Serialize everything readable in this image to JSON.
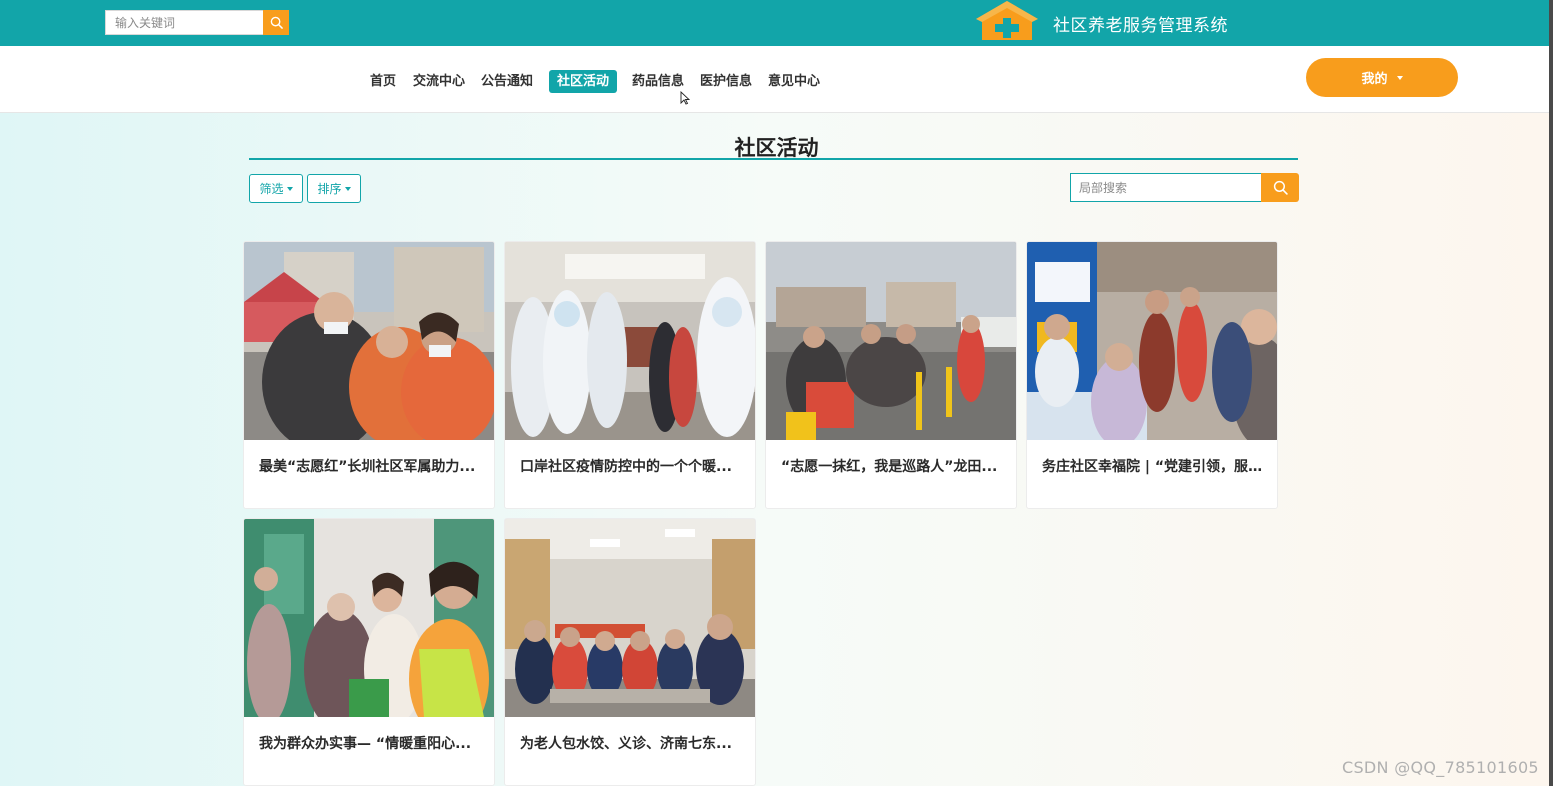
{
  "topbar": {
    "search_placeholder": "输入关键词",
    "search_icon": "search-icon",
    "brand_title": "社区养老服务管理系统",
    "brand_icon": "house-plus-icon",
    "bg_color": "#12a5a9"
  },
  "nav": {
    "items": [
      {
        "label": "首页"
      },
      {
        "label": "交流中心"
      },
      {
        "label": "公告通知"
      },
      {
        "label": "社区活动",
        "active": true
      },
      {
        "label": "药品信息"
      },
      {
        "label": "医护信息"
      },
      {
        "label": "意见中心"
      }
    ],
    "user_menu": "我的"
  },
  "page": {
    "title": "社区活动",
    "filter_label": "筛选",
    "sort_label": "排序",
    "local_search_placeholder": "局部搜索"
  },
  "cards": [
    {
      "title": "最美“志愿红”长圳社区军属助力..."
    },
    {
      "title": "口岸社区疫情防控中的一个个暖..."
    },
    {
      "title": "“志愿一抹红，我是巡路人”龙田..."
    },
    {
      "title": "务庄社区幸福院 | “党建引领，服..."
    },
    {
      "title": "我为群众办实事— “情暖重阳心..."
    },
    {
      "title": "为老人包水饺、义诊、济南七东..."
    }
  ],
  "watermark": "CSDN @QQ_785101605",
  "colors": {
    "accent": "#12a5a9",
    "orange": "#f89d1c"
  }
}
